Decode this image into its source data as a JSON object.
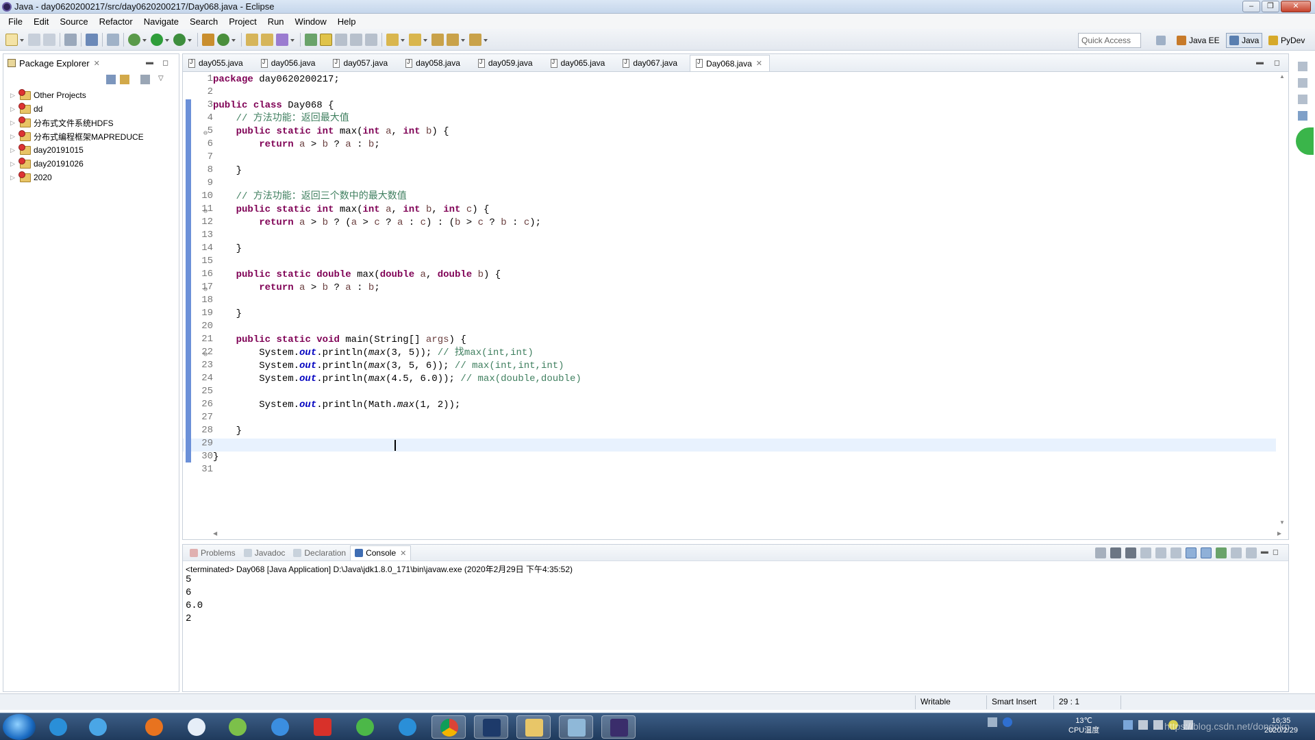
{
  "window": {
    "title": "Java - day0620200217/src/day0620200217/Day068.java - Eclipse",
    "buttons": [
      "–",
      "❐",
      "✕"
    ]
  },
  "menu": [
    "File",
    "Edit",
    "Source",
    "Refactor",
    "Navigate",
    "Search",
    "Project",
    "Run",
    "Window",
    "Help"
  ],
  "toolbar": {
    "quick_access": "Quick Access",
    "perspectives": [
      "Java EE",
      "Java",
      "PyDev"
    ]
  },
  "package_explorer": {
    "title": "Package Explorer",
    "items": [
      "Other Projects",
      "dd",
      "分布式文件系统HDFS",
      "分布式编程框架MAPREDUCE",
      "day20191015",
      "day20191026",
      "2020"
    ]
  },
  "editor": {
    "tabs": [
      "day055.java",
      "day056.java",
      "day057.java",
      "day058.java",
      "day059.java",
      "day065.java",
      "day067.java",
      "Day068.java"
    ],
    "active_tab": "Day068.java",
    "line_numbers": [
      "1",
      "2",
      "3",
      "4",
      "5",
      "6",
      "7",
      "8",
      "9",
      "10",
      "11",
      "12",
      "13",
      "14",
      "15",
      "16",
      "17",
      "18",
      "19",
      "20",
      "21",
      "22",
      "23",
      "24",
      "25",
      "26",
      "27",
      "28",
      "29",
      "30",
      "31"
    ]
  },
  "console": {
    "tabs": [
      "Problems",
      "Javadoc",
      "Declaration",
      "Console"
    ],
    "active_tab": "Console",
    "terminated": "<terminated> Day068 [Java Application] D:\\Java\\jdk1.8.0_171\\bin\\javaw.exe (2020年2月29日 下午4:35:52)",
    "output": [
      "5",
      "6",
      "6.0",
      "2"
    ]
  },
  "status": {
    "writable": "Writable",
    "insert": "Smart Insert",
    "position": "29 : 1"
  },
  "taskbar": {
    "temp": "13℃",
    "cpu": "CPU温度",
    "time": "16:35",
    "date": "2020/2/29",
    "watermark": "https://blog.csdn.net/dongokp"
  }
}
